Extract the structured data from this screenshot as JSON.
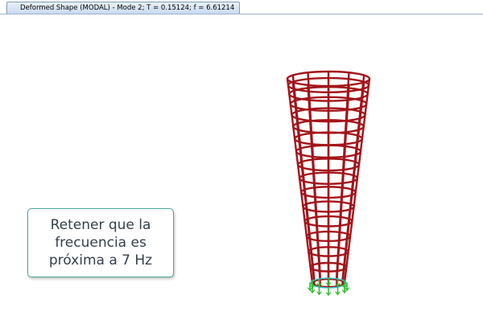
{
  "window": {
    "tab_title": "Deformed Shape (MODAL) - Mode 2; T = 0.15124;  f = 6.61214"
  },
  "note": {
    "text": "Retener que la frecuencia es próxima a 7 Hz"
  },
  "model": {
    "frame_color": "#a3141a",
    "support_color": "#2fbf2f",
    "base_marker_color": "#37c7d6",
    "icons": [
      "tower-frame-icon",
      "support-icon"
    ]
  }
}
